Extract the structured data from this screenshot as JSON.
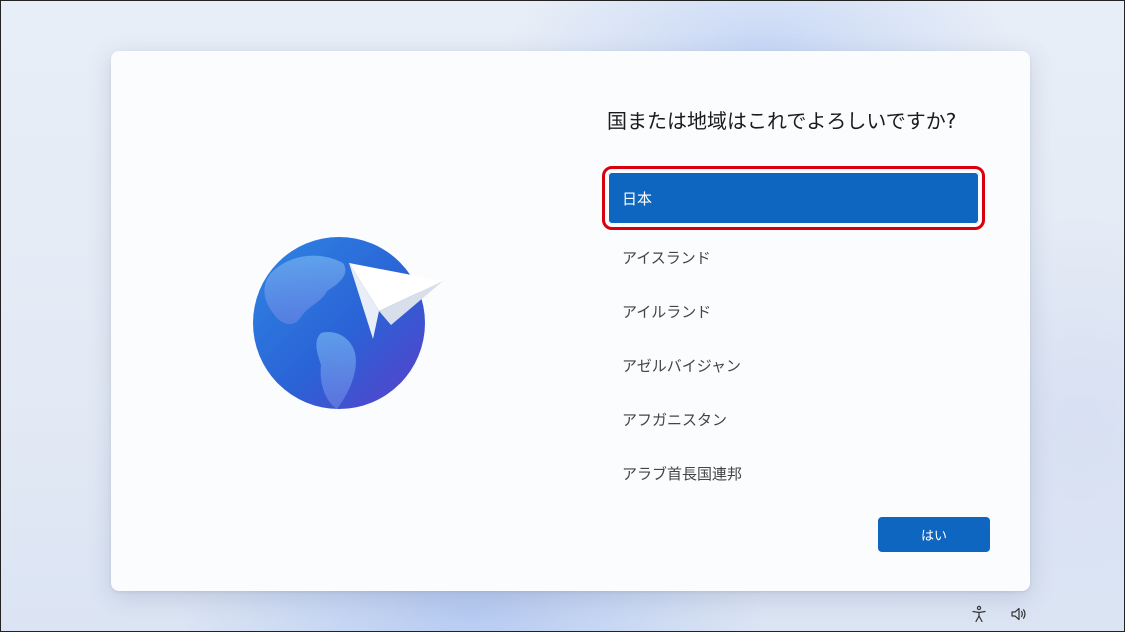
{
  "setup": {
    "question": "国または地域はこれでよろしいですか?",
    "countries": [
      {
        "label": "日本",
        "selected": true
      },
      {
        "label": "アイスランド",
        "selected": false
      },
      {
        "label": "アイルランド",
        "selected": false
      },
      {
        "label": "アゼルバイジャン",
        "selected": false
      },
      {
        "label": "アフガニスタン",
        "selected": false
      },
      {
        "label": "アラブ首長国連邦",
        "selected": false
      }
    ],
    "yes_label": "はい"
  },
  "icons": {
    "illustration": "globe-paper-plane-icon",
    "accessibility": "accessibility-icon",
    "volume": "volume-icon"
  },
  "colors": {
    "accent": "#0f66c0",
    "highlight_border": "#d8000c"
  }
}
